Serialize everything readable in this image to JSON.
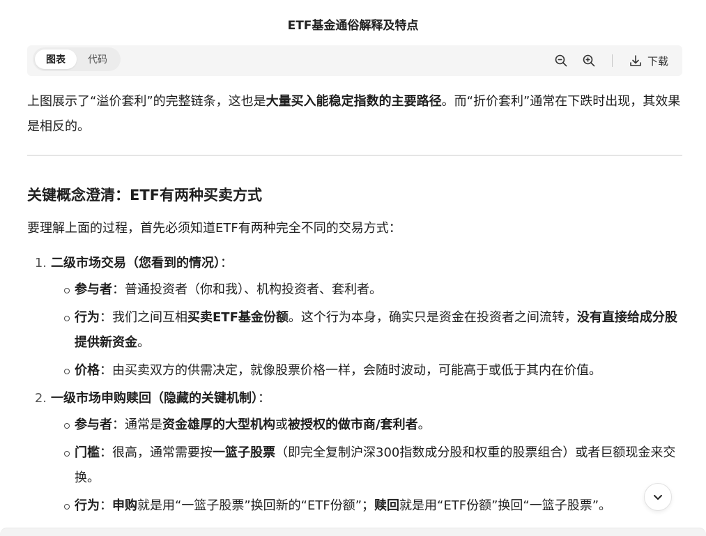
{
  "title": "ETF基金通俗解释及特点",
  "tabs": [
    {
      "label": "图表",
      "active": true
    },
    {
      "label": "代码",
      "active": false
    }
  ],
  "tools": {
    "zoom_out": "zoom-out-icon",
    "zoom_in": "zoom-in-icon",
    "download_label": "下载"
  },
  "para1": {
    "t1": "上图展示了“溢价套利”的完整链条，这也是",
    "b1": "大量买入能稳定指数的主要路径",
    "t2": "。而“折价套利”通常在下跌时出现，其效果是相反的。"
  },
  "heading": "关键概念澄清：ETF有两种买卖方式",
  "para2": "要理解上面的过程，首先必须知道ETF有两种完全不同的交易方式：",
  "list": [
    {
      "num": "1.",
      "title": "二级市场交易（您看到的情况）",
      "suffix": "：",
      "items": [
        {
          "label": "参与者",
          "t1": "：普通投资者（你和我）、机构投资者、套利者。"
        },
        {
          "label": "行为",
          "t1": "：我们之间互相",
          "b1": "买卖ETF基金份额",
          "t2": "。这个行为本身，确实只是资金在投资者之间流转，",
          "b2": "没有直接给成分股提供新资金",
          "t3": "。"
        },
        {
          "label": "价格",
          "t1": "：由买卖双方的供需决定，就像股票价格一样，会随时波动，可能高于或低于其内在价值。"
        }
      ]
    },
    {
      "num": "2.",
      "title": "一级市场申购赎回（隐藏的关键机制）",
      "suffix": "：",
      "items": [
        {
          "label": "参与者",
          "t1": "：通常是",
          "b1": "资金雄厚的大型机构",
          "t2": "或",
          "b2": "被授权的做市商/套利者",
          "t3": "。"
        },
        {
          "label": "门槛",
          "t1": "：很高，通常需要按",
          "b1": "一篮子股票",
          "t2": "（即完全复制沪深300指数成分股和权重的股票组合）或者巨额现金来交换。"
        },
        {
          "label": "行为",
          "t1": "：",
          "b1": "申购",
          "t2": "就是用“一篮子股票”换回新的“ETF份额”；",
          "b2": "赎回",
          "t3": "就是用“ETF份额”换回“一篮子股票”。"
        }
      ]
    }
  ],
  "colors": {
    "accent_bg": "#f5f5f5",
    "text": "#1f1f1f",
    "divider": "#e5e5e5"
  }
}
